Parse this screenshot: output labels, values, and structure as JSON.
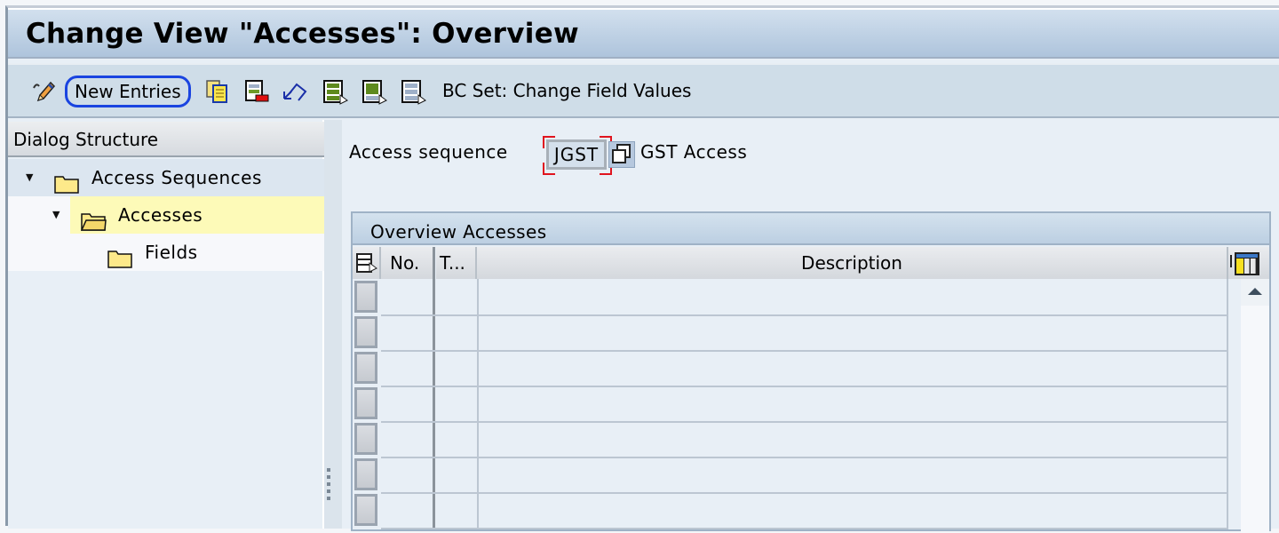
{
  "window": {
    "title": "Change View \"Accesses\": Overview"
  },
  "toolbar": {
    "items": [
      {
        "icon": "display-change-icon"
      },
      {
        "label": "New Entries"
      },
      {
        "icon": "copy-as-icon"
      },
      {
        "icon": "delete-icon"
      },
      {
        "icon": "undo-change-icon"
      },
      {
        "icon": "select-all-icon"
      },
      {
        "icon": "select-block-icon"
      },
      {
        "icon": "deselect-all-icon"
      },
      {
        "label": "BC Set: Change Field Values"
      }
    ],
    "new_entries_label": "New Entries",
    "bcset_label": "BC Set: Change Field Values"
  },
  "dialog_structure": {
    "header": "Dialog Structure",
    "items": [
      {
        "label": "Access Sequences",
        "expanded": true,
        "level": 0
      },
      {
        "label": "Accesses",
        "expanded": true,
        "level": 1,
        "selected": true
      },
      {
        "label": "Fields",
        "level": 2
      }
    ]
  },
  "form": {
    "access_sequence_label": "Access sequence",
    "access_sequence_value": "JGST",
    "access_sequence_desc": "GST Access"
  },
  "table": {
    "title": "Overview Accesses",
    "columns": [
      "No.",
      "T...",
      "Description"
    ],
    "rows": [
      {
        "no": "",
        "t": "",
        "description": ""
      },
      {
        "no": "",
        "t": "",
        "description": ""
      },
      {
        "no": "",
        "t": "",
        "description": ""
      },
      {
        "no": "",
        "t": "",
        "description": ""
      },
      {
        "no": "",
        "t": "",
        "description": ""
      },
      {
        "no": "",
        "t": "",
        "description": ""
      },
      {
        "no": "",
        "t": "",
        "description": ""
      }
    ]
  },
  "colors": {
    "highlight": "#1a44e0",
    "selected_node": "#fdfab8",
    "required_marker": "#e0141e"
  }
}
